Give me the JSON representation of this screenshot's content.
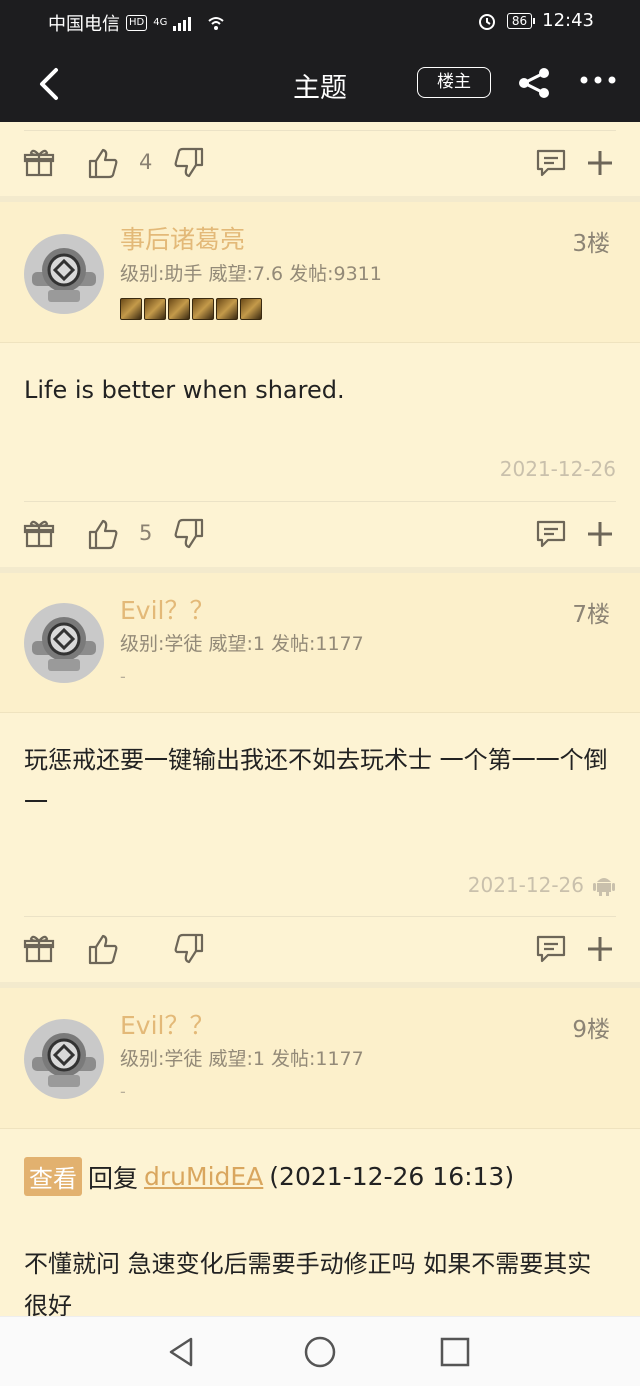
{
  "status_bar": {
    "carrier": "中国电信",
    "hd": "HD",
    "network": "4G",
    "battery": "86",
    "time": "12:43"
  },
  "nav": {
    "title": "主题",
    "owner_button": "楼主"
  },
  "posts": [
    {
      "floor": "3楼",
      "username": "事后诸葛亮",
      "level": "级别:助手 威望:7.6 发帖:9311",
      "content": "Life is better when shared.",
      "date": "2021-12-26",
      "likes": "5"
    },
    {
      "floor": "7楼",
      "username": "Evil？？",
      "level": "级别:学徒 威望:1 发帖:1177",
      "signature": "-",
      "content": "玩惩戒还要一键输出我还不如去玩术士 一个第一一个倒一",
      "date": "2021-12-26",
      "likes": ""
    },
    {
      "floor": "9楼",
      "username": "Evil？？",
      "level": "级别:学徒 威望:1 发帖:1177",
      "signature": "-",
      "view_label": "查看",
      "reply_prefix": "回复",
      "reply_user": "druMidEA",
      "reply_time": "(2021-12-26 16:13)",
      "content": "不懂就问 急速变化后需要手动修正吗 如果不需要其实很好"
    }
  ],
  "top_action": {
    "likes": "4"
  }
}
